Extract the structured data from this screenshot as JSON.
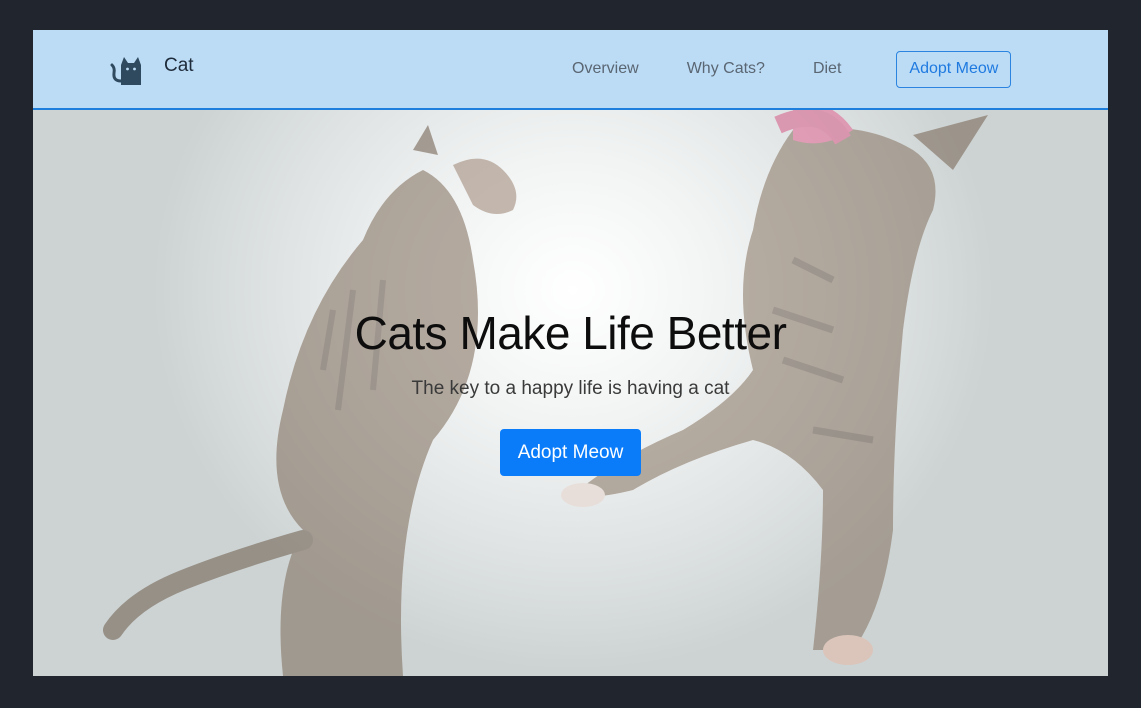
{
  "brand": {
    "name": "Cat",
    "logo_icon": "cat-silhouette-icon"
  },
  "nav": {
    "links": [
      "Overview",
      "Why Cats?",
      "Diet"
    ],
    "cta_label": "Adopt Meow"
  },
  "hero": {
    "title": "Cats Make Life Better",
    "subtitle": "The key to a happy life is having a cat",
    "cta_label": "Adopt Meow",
    "background_image": "two-cats-jumping-image"
  },
  "colors": {
    "navbar_bg": "#bcdcf6",
    "navbar_border": "#1f7fdc",
    "primary": "#0a7cfa",
    "page_bg": "#21252d"
  }
}
